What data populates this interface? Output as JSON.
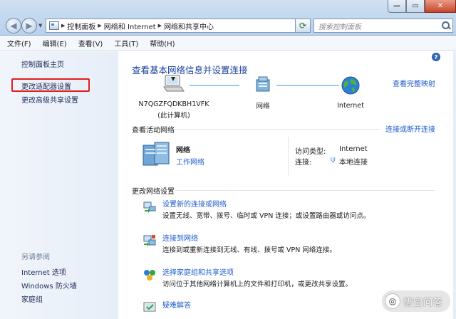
{
  "window": {
    "minimize": "—",
    "maximize": "▭",
    "close": "✕"
  },
  "address_bar": {
    "breadcrumbs": [
      "控制面板",
      "网络和 Internet",
      "网络和共享中心"
    ],
    "search_placeholder": "搜索控制面板"
  },
  "menu": {
    "items": [
      "文件(F)",
      "编辑(E)",
      "查看(V)",
      "工具(T)",
      "帮助(H)"
    ]
  },
  "sidebar": {
    "home": "控制面板主页",
    "links": [
      "更改适配器设置",
      "更改高级共享设置"
    ],
    "see_also_header": "另请参阅",
    "see_also": [
      "Internet 选项",
      "Windows 防火墙",
      "家庭组"
    ]
  },
  "main": {
    "title": "查看基本网络信息并设置连接",
    "view_full_map": "查看完整映射",
    "map": {
      "computer_name": "N7QGZFQDKBH1VFK",
      "computer_sub": "(此计算机)",
      "network": "网络",
      "internet": "Internet"
    },
    "active_networks": {
      "label": "查看活动网络",
      "connect_disconnect": "连接或断开连接",
      "network_name": "网络",
      "network_type": "工作网络",
      "access_type_key": "访问类型:",
      "access_type_val": "Internet",
      "connections_key": "连接:",
      "connections_val": "本地连接"
    },
    "change_settings": {
      "label": "更改网络设置",
      "tasks": [
        {
          "title": "设置新的连接或网络",
          "desc": "设置无线、宽带、拨号、临时或 VPN 连接；或设置路由器或访问点。",
          "icon": "new-connection-icon"
        },
        {
          "title": "连接到网络",
          "desc": "连接到或重新连接到无线、有线、拨号或 VPN 网络连接。",
          "icon": "connect-network-icon"
        },
        {
          "title": "选择家庭组和共享选项",
          "desc": "访问位于其他网络计算机上的文件和打印机，或更改共享设置。",
          "icon": "homegroup-icon"
        },
        {
          "title": "疑难解答",
          "desc": "",
          "icon": "troubleshoot-icon"
        }
      ]
    }
  },
  "watermark": "悟空问答",
  "colors": {
    "link": "#1f5ccc",
    "title": "#1a3e9e",
    "highlight": "#e01f1f"
  }
}
